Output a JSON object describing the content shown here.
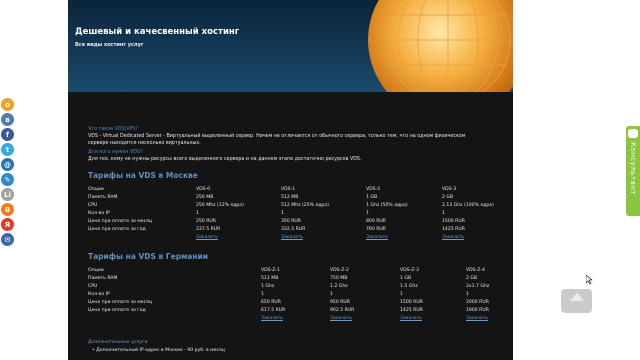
{
  "header": {
    "title": "Дешевый и качесвенный хостинг",
    "subtitle": "Все виды хостинг услуг"
  },
  "intro": {
    "q1": "Что такое VDS/VPS?",
    "a1_line1": "VDS - Virtual Dedicated Server - Виртуальный выделенный сервер. Ничем не отличается от обычного сервера, только тем, что на одном физическом",
    "a1_line2": "сервере находится несколько виртуальных.",
    "q2": "Для кого нужен VDS?",
    "a2": "Для тех, кому не нужны ресурсы всего выделенного сервера и на данном этапе достаточно ресурсов VDS."
  },
  "moscow": {
    "heading": "Тарифы на VDS в Москве",
    "columns": [
      "Опции",
      "VDS-0",
      "VDS-1",
      "VDS-2",
      "VDS-3"
    ],
    "rows": [
      [
        "Память RAM",
        "256 MB",
        "512 MB",
        "1 GB",
        "2 GB"
      ],
      [
        "CPU",
        "256 Mhz (12% ядра)",
        "512 Mhz (25% ядра)",
        "1 Ghz (50% ядра)",
        "2.13 Ghz (100% ядра)"
      ],
      [
        "Кол-во IP",
        "1",
        "1",
        "1",
        "1"
      ],
      [
        "Цена при оплате за месяц",
        "250 RUR",
        "350 RUR",
        "800 RUR",
        "1500 RUR"
      ],
      [
        "Цена при оплате за год",
        "237.5 RUR",
        "332.5 RUR",
        "760 RUR",
        "1425 RUR"
      ]
    ],
    "order_label": "Заказать"
  },
  "germany": {
    "heading": "Тарифы на VDS в Германии",
    "columns": [
      "Опции",
      "VDS-Z-1",
      "VDS-Z-2",
      "VDS-Z-3",
      "VDS-Z-4"
    ],
    "rows": [
      [
        "Память RAM",
        "512 MB",
        "750 MB",
        "1 GB",
        "2 GB"
      ],
      [
        "CPU",
        "1 Ghz",
        "1.2 Ghz",
        "1.5 Ghz",
        "2x1.7 Ghz"
      ],
      [
        "Кол-во IP",
        "1",
        "1",
        "1",
        "1"
      ],
      [
        "Цена при оплате за месяц",
        "650 RUR",
        "950 RUR",
        "1500 RUR",
        "2000 RUR"
      ],
      [
        "Цена при оплате за год",
        "617.5 RUR",
        "902.5 RUR",
        "1425 RUR",
        "1900 RUR"
      ]
    ],
    "order_label": "Заказать"
  },
  "extras": {
    "heading": "Дополнительные услуги",
    "item1": "Дополнительный IP-адрес в Москве - 90 руб. в месяц"
  },
  "consult": {
    "label": "Консультант"
  },
  "social": [
    {
      "icon": "odnoklassniki-icon",
      "glyph": "о",
      "color": "#f2a028"
    },
    {
      "icon": "vk-icon",
      "glyph": "в",
      "color": "#4e7ab5"
    },
    {
      "icon": "facebook-icon",
      "glyph": "f",
      "color": "#3b5998"
    },
    {
      "icon": "twitter-icon",
      "glyph": "t",
      "color": "#38a8e0"
    },
    {
      "icon": "mailru-icon",
      "glyph": "@",
      "color": "#2d6fb8"
    },
    {
      "icon": "livejournal-icon",
      "glyph": "✎",
      "color": "#2a8ccf"
    },
    {
      "icon": "liveinternet-icon",
      "glyph": "Li",
      "color": "#a0a0a0"
    },
    {
      "icon": "blogger-icon",
      "glyph": "B",
      "color": "#f07b1a"
    },
    {
      "icon": "yandex-icon",
      "glyph": "Я",
      "color": "#e03a2e"
    },
    {
      "icon": "email-icon",
      "glyph": "✉",
      "color": "#3d66b0"
    }
  ],
  "colors": {
    "page_bg": "#141414",
    "heading": "#5f8fbf",
    "link": "#6c9cc9",
    "consult": "#8cc63f"
  }
}
